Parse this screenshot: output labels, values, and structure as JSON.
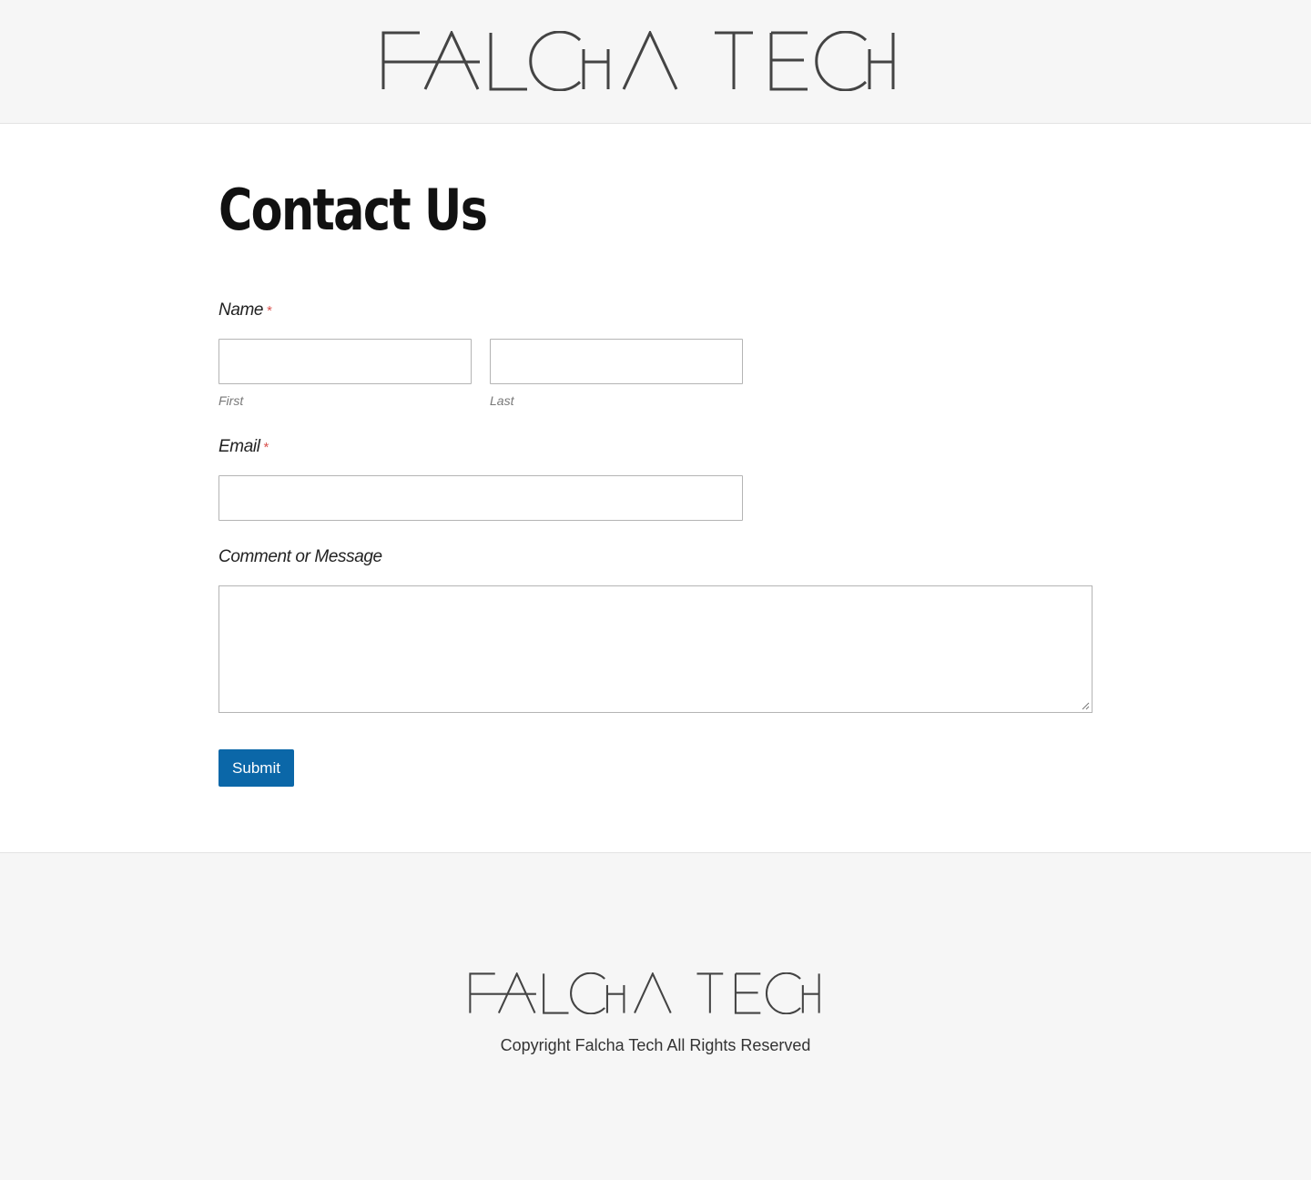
{
  "header": {
    "logo_text": "FALCHA TECH"
  },
  "main": {
    "title": "Contact Us",
    "form": {
      "name_label": "Name",
      "required_marker": "*",
      "first_sublabel": "First",
      "last_sublabel": "Last",
      "first_value": "",
      "last_value": "",
      "email_label": "Email",
      "email_value": "",
      "message_label": "Comment or Message",
      "message_value": "",
      "submit_label": "Submit"
    }
  },
  "footer": {
    "logo_text": "FALCHA TECH",
    "copyright": "Copyright Falcha Tech All Rights Reserved"
  },
  "colors": {
    "accent": "#0b67a8",
    "required": "#d9534f",
    "band_background": "#f6f6f6",
    "logo": "#444444"
  }
}
